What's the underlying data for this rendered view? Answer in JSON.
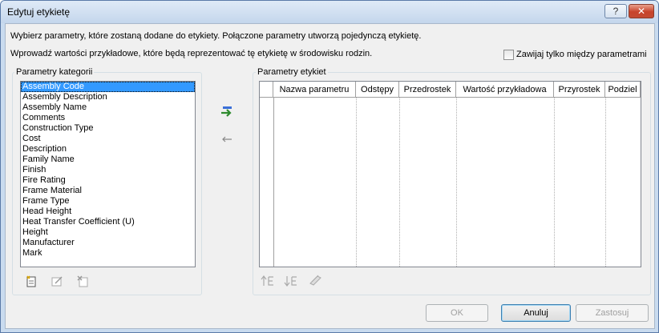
{
  "window": {
    "title": "Edytuj etykietę",
    "help_label": "?",
    "close_label": "✕"
  },
  "instructions": {
    "line1": "Wybierz parametry, które zostaną dodane do etykiety. Połączone parametry utworzą pojedynczą etykietę.",
    "line2": "Wprowadź wartości przykładowe, które będą reprezentować tę etykietę w środowisku rodzin."
  },
  "wrap_checkbox": {
    "label": "Zawijaj tylko między parametrami",
    "checked": false
  },
  "category_params": {
    "label": "Parametry kategorii",
    "items": [
      "Assembly Code",
      "Assembly Description",
      "Assembly Name",
      "Comments",
      "Construction Type",
      "Cost",
      "Description",
      "Family Name",
      "Finish",
      "Fire Rating",
      "Frame Material",
      "Frame Type",
      "Head Height",
      "Heat Transfer Coefficient (U)",
      "Height",
      "Manufacturer",
      "Mark"
    ],
    "selected_index": 0
  },
  "label_params": {
    "label": "Parametry etykiet",
    "columns": [
      "Nazwa parametru",
      "Odstępy",
      "Przedrostek",
      "Wartość przykładowa",
      "Przyrostek",
      "Podziel"
    ]
  },
  "buttons": {
    "ok": "OK",
    "cancel": "Anuluj",
    "apply": "Zastosuj"
  },
  "colors": {
    "selection": "#3399ff",
    "add_arrow": "#2e8b2e",
    "title_gradient_top": "#dfeaf7"
  }
}
